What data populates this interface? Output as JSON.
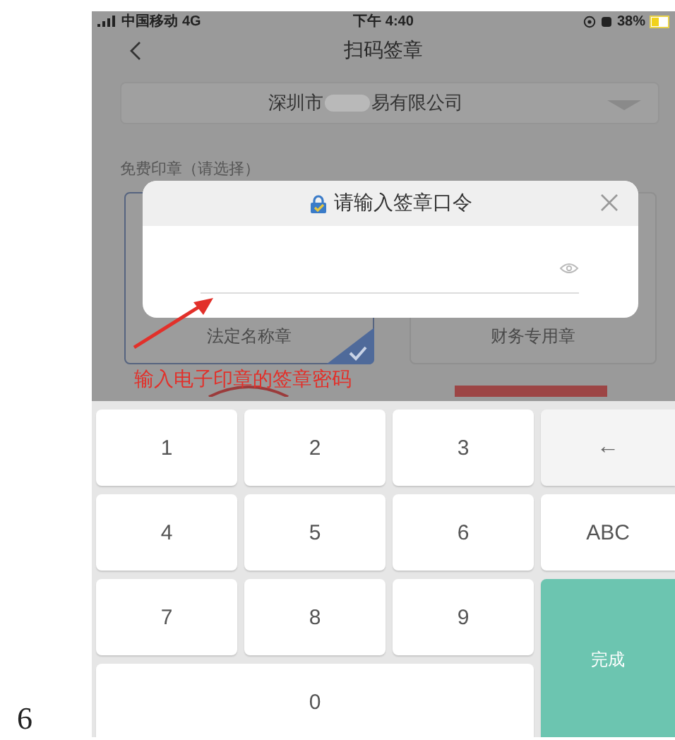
{
  "status_bar": {
    "carrier": "中国移动",
    "network": "4G",
    "time": "下午 4:40",
    "battery": "38%"
  },
  "nav": {
    "title": "扫码签章"
  },
  "company": {
    "name_start": "深圳市",
    "name_end": "易有限公司"
  },
  "section_label": "免费印章（请选择）",
  "seals": [
    {
      "name": "法定名称章",
      "selected": true
    },
    {
      "name": "财务专用章",
      "selected": false
    }
  ],
  "dialog": {
    "title": "请输入签章口令"
  },
  "annotation": "输入电子印章的签章密码",
  "keypad": [
    {
      "label": "1",
      "kind": "digit"
    },
    {
      "label": "2",
      "kind": "digit"
    },
    {
      "label": "3",
      "kind": "digit"
    },
    {
      "label": "←",
      "kind": "backspace"
    },
    {
      "label": "4",
      "kind": "digit"
    },
    {
      "label": "5",
      "kind": "digit"
    },
    {
      "label": "6",
      "kind": "digit"
    },
    {
      "label": "ABC",
      "kind": "mode"
    },
    {
      "label": "7",
      "kind": "digit"
    },
    {
      "label": "8",
      "kind": "digit"
    },
    {
      "label": "9",
      "kind": "digit"
    },
    {
      "label": "完成",
      "kind": "done"
    },
    {
      "label": "0",
      "kind": "zero"
    }
  ],
  "page_number": "6"
}
